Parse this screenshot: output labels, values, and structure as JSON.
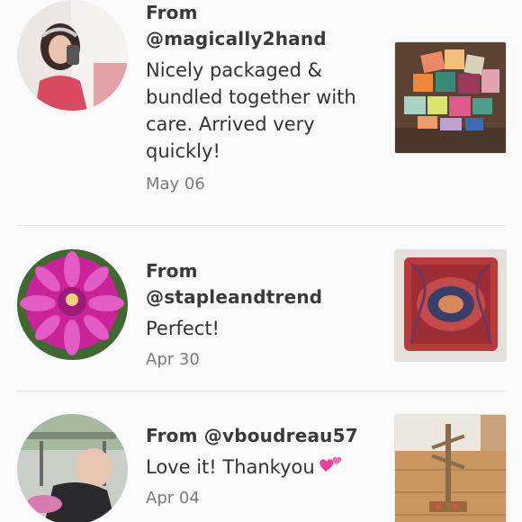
{
  "reviews": [
    {
      "from": "From @magically2hand",
      "text": "Nicely packaged & bundled together with care. Arrived very quickly!",
      "date": "May 06",
      "avatar_icon": "user-avatar-icon",
      "thumb_icon": "fabric-bundle-photo"
    },
    {
      "from": "From @stapleandtrend",
      "text": "Perfect!",
      "date": "Apr 30",
      "avatar_icon": "dahlia-flower-avatar",
      "thumb_icon": "paisley-pillow-photo"
    },
    {
      "from": "From @vboudreau57",
      "text": "Love it! Thankyou",
      "date": "Apr 04",
      "avatar_icon": "baby-avatar",
      "thumb_icon": "wooden-stand-photo",
      "emoji": "two-hearts-emoji"
    }
  ],
  "colors": {
    "background": "#fbfafb",
    "divider": "#e6e4e6",
    "date_text": "#7a7a7a",
    "heart": "#e9409a"
  }
}
